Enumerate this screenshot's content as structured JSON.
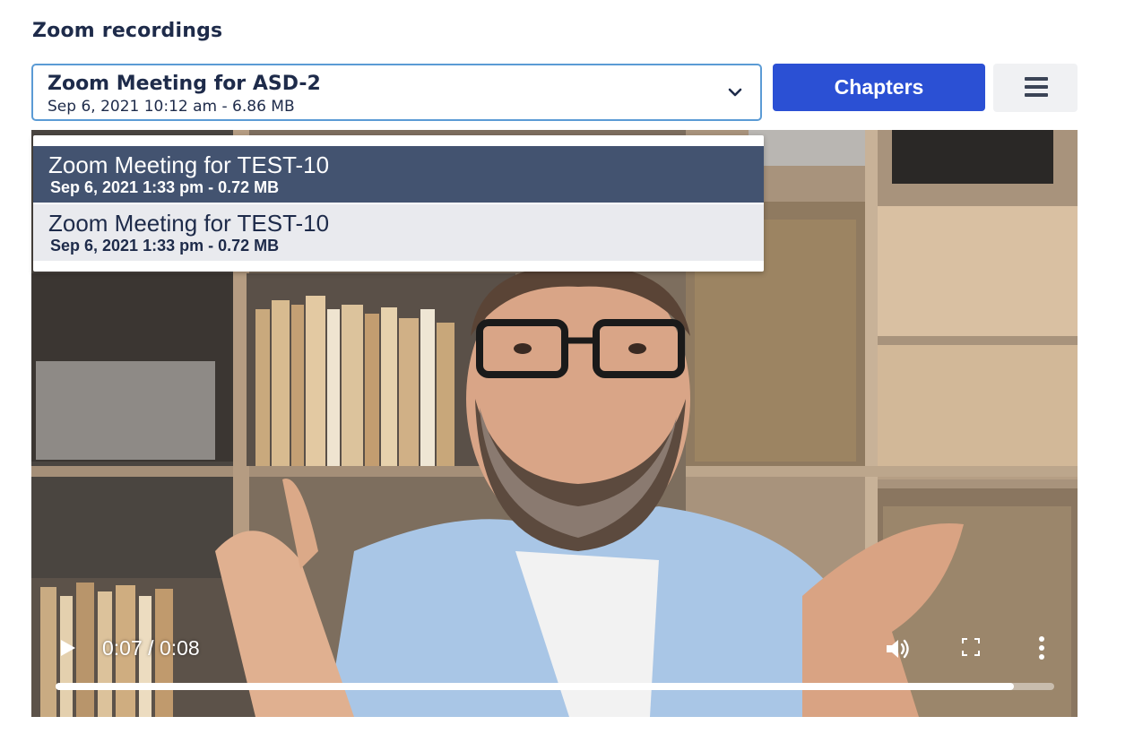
{
  "header": {
    "title": "Zoom recordings"
  },
  "select": {
    "selected_title": "Zoom Meeting for ASD-2",
    "selected_sub": "Sep 6, 2021 10:12 am - 6.86 MB",
    "options": [
      {
        "title": "Zoom Meeting for TEST-10",
        "sub": "Sep 6, 2021 1:33 pm - 0.72 MB"
      },
      {
        "title": "Zoom Meeting for TEST-10",
        "sub": "Sep 6, 2021 1:33 pm - 0.72 MB"
      }
    ]
  },
  "toolbar": {
    "chapters_label": "Chapters"
  },
  "player": {
    "current_time": "0:07",
    "separator": " / ",
    "duration": "0:08",
    "progress_fraction": 0.96
  },
  "colors": {
    "accent": "#2b50d4",
    "select_border": "#5b9bd5",
    "option_selected_bg": "#435370",
    "option_bg": "#e9eaee"
  }
}
